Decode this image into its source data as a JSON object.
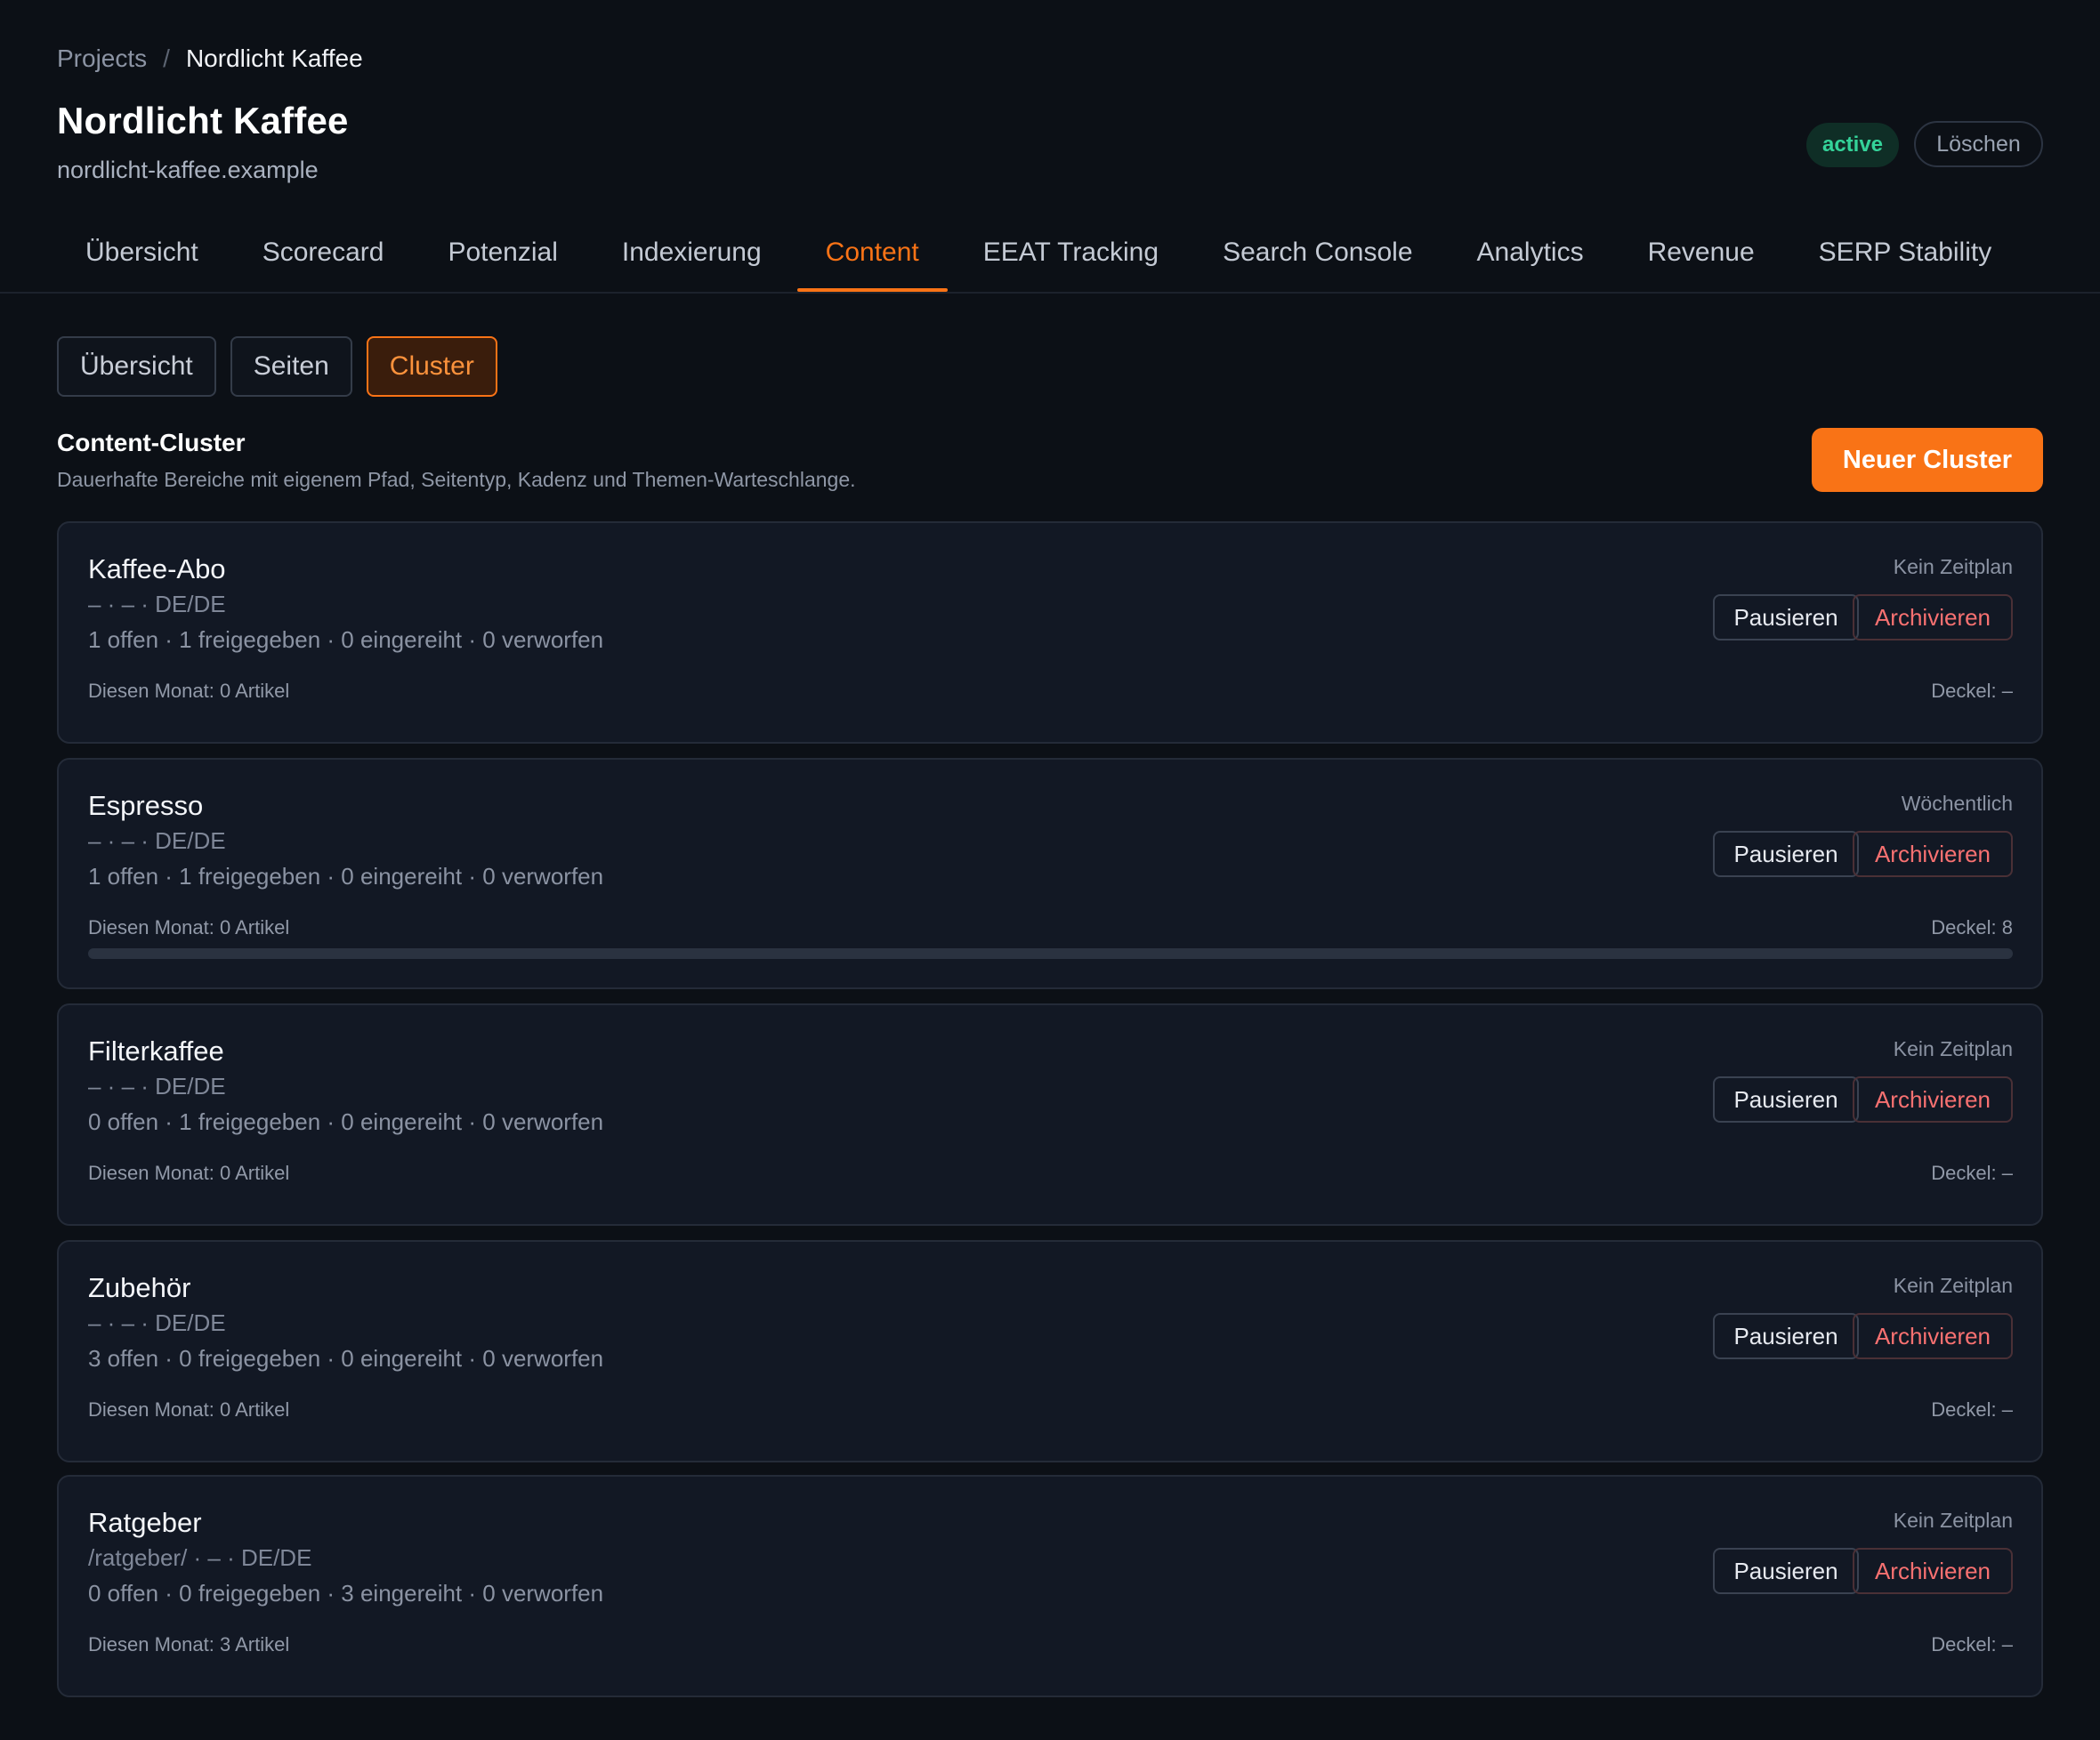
{
  "breadcrumb": {
    "root": "Projects",
    "separator": "/",
    "current": "Nordlicht Kaffee"
  },
  "project": {
    "title": "Nordlicht Kaffee",
    "domain": "nordlicht-kaffee.example",
    "status": "active",
    "delete_label": "Löschen"
  },
  "tabs": [
    {
      "label": "Übersicht",
      "active": false
    },
    {
      "label": "Scorecard",
      "active": false
    },
    {
      "label": "Potenzial",
      "active": false
    },
    {
      "label": "Indexierung",
      "active": false
    },
    {
      "label": "Content",
      "active": true
    },
    {
      "label": "EEAT Tracking",
      "active": false
    },
    {
      "label": "Search Console",
      "active": false
    },
    {
      "label": "Analytics",
      "active": false
    },
    {
      "label": "Revenue",
      "active": false
    },
    {
      "label": "SERP Stability",
      "active": false
    }
  ],
  "subtabs": [
    {
      "label": "Übersicht",
      "active": false
    },
    {
      "label": "Seiten",
      "active": false
    },
    {
      "label": "Cluster",
      "active": true
    }
  ],
  "section": {
    "title": "Content-Cluster",
    "description": "Dauerhafte Bereiche mit eigenem Pfad, Seitentyp, Kadenz und Themen-Warteschlange.",
    "new_button": "Neuer Cluster"
  },
  "actions": {
    "pause": "Pausieren",
    "archive": "Archivieren"
  },
  "clusters": [
    {
      "name": "Kaffee-Abo",
      "path": "– · – · DE/DE",
      "stats": "1 offen · 1 freigegeben · 0 eingereiht · 0 verworfen",
      "month": "Diesen Monat: 0 Artikel",
      "schedule": "Kein Zeitplan",
      "cap": "Deckel: –",
      "progress": null
    },
    {
      "name": "Espresso",
      "path": "– · – · DE/DE",
      "stats": "1 offen · 1 freigegeben · 0 eingereiht · 0 verworfen",
      "month": "Diesen Monat: 0 Artikel",
      "schedule": "Wöchentlich",
      "cap": "Deckel: 8",
      "progress": 0
    },
    {
      "name": "Filterkaffee",
      "path": "– · – · DE/DE",
      "stats": "0 offen · 1 freigegeben · 0 eingereiht · 0 verworfen",
      "month": "Diesen Monat: 0 Artikel",
      "schedule": "Kein Zeitplan",
      "cap": "Deckel: –",
      "progress": null
    },
    {
      "name": "Zubehör",
      "path": "– · – · DE/DE",
      "stats": "3 offen · 0 freigegeben · 0 eingereiht · 0 verworfen",
      "month": "Diesen Monat: 0 Artikel",
      "schedule": "Kein Zeitplan",
      "cap": "Deckel: –",
      "progress": null
    },
    {
      "name": "Ratgeber",
      "path": "/ratgeber/ · – · DE/DE",
      "stats": "0 offen · 0 freigegeben · 3 eingereiht · 0 verworfen",
      "month": "Diesen Monat: 3 Artikel",
      "schedule": "Kein Zeitplan",
      "cap": "Deckel: –",
      "progress": null
    }
  ],
  "colors": {
    "accent": "#f97316",
    "status_active": "#34d399",
    "danger": "#f87171",
    "background": "#0c1016",
    "card": "#121824"
  }
}
